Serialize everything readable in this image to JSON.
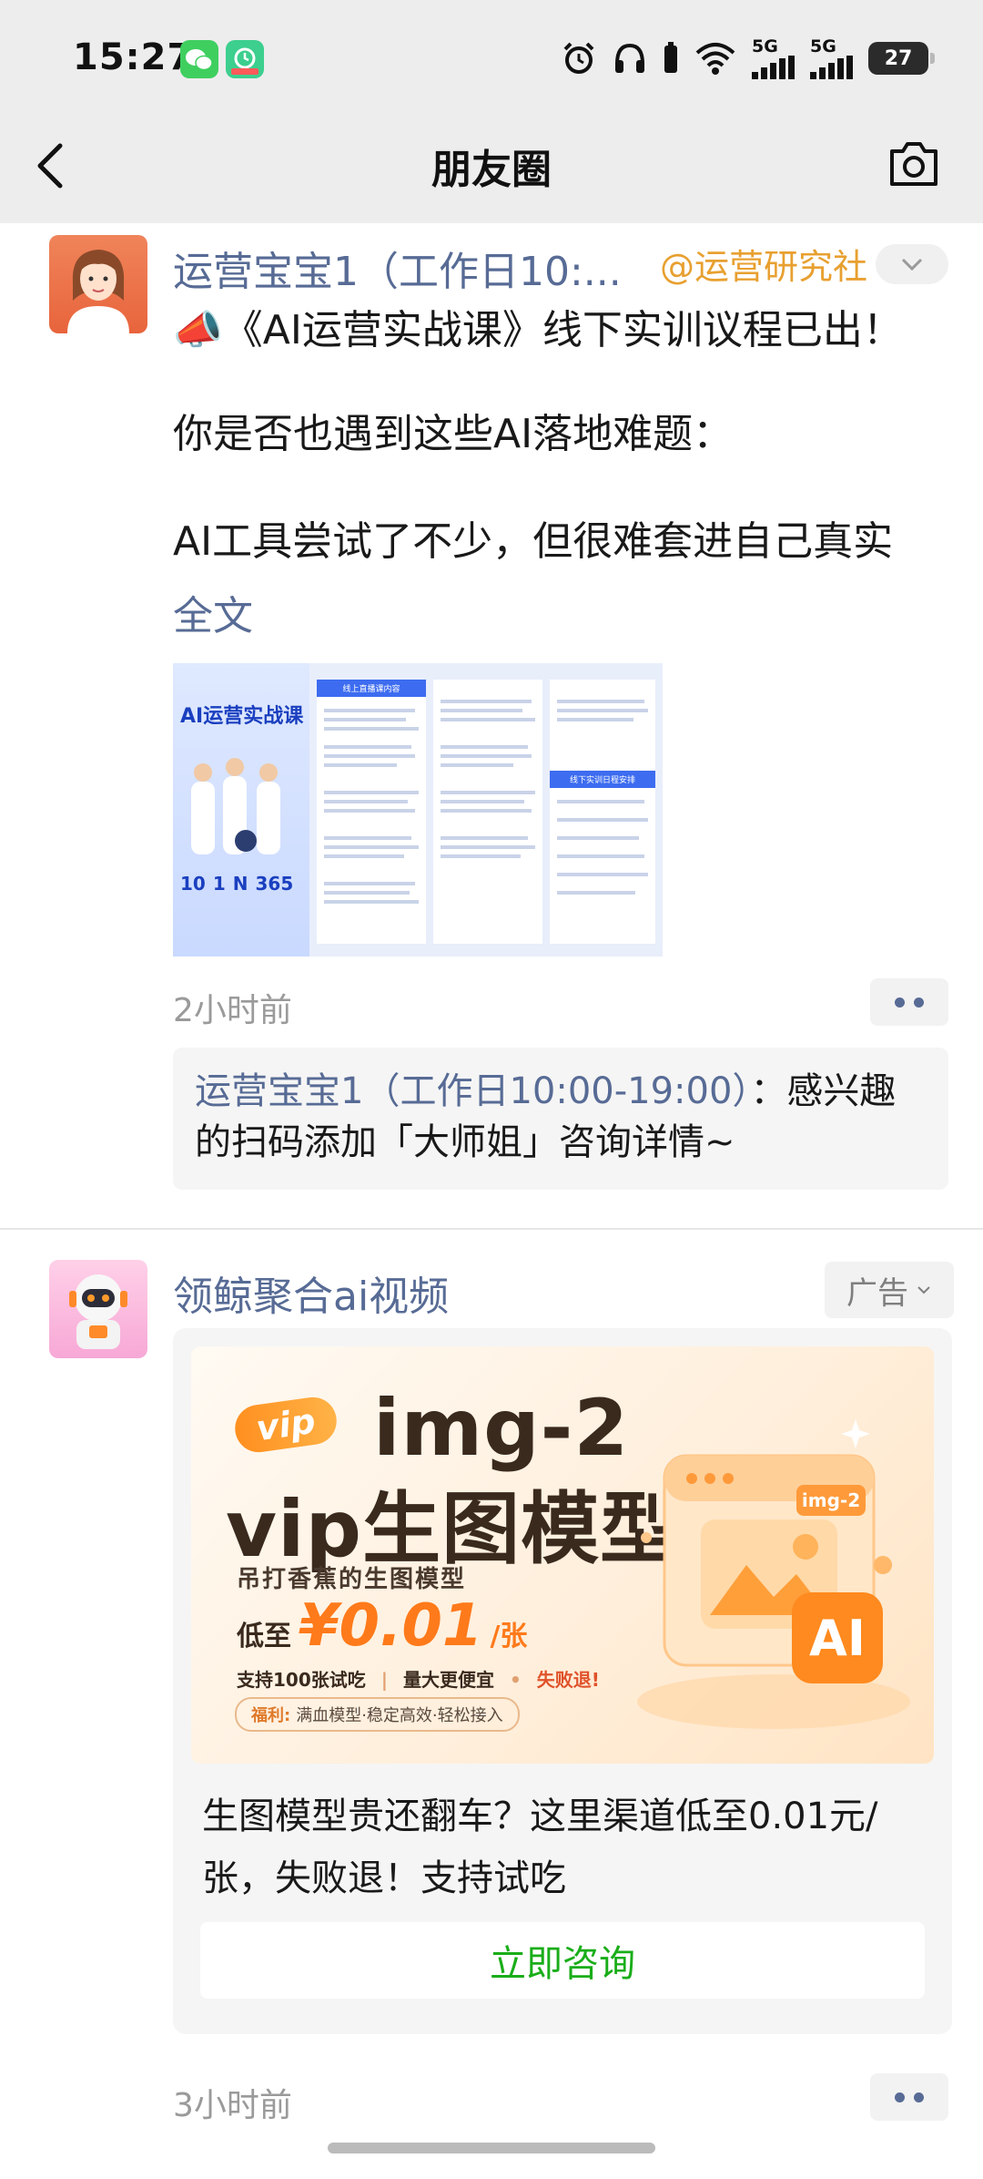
{
  "status_bar": {
    "time": "15:27",
    "signal_1": "5G",
    "signal_2": "5G",
    "battery": "27"
  },
  "nav": {
    "title": "朋友圈"
  },
  "post1": {
    "author": "运营宝宝1（工作日10:...",
    "mention": "@运营研究社",
    "lines": [
      "📣《AI运营实战课》线下实训议程已出！",
      "你是否也遇到这些AI落地难题：",
      "AI工具尝试了不少，但很难套进自己真实"
    ],
    "expand": "全文",
    "poster": {
      "title": "AI运营实战课",
      "section_1": "线上直播课内容",
      "section_2": "线下实训日程安排",
      "stats": [
        "10",
        "1",
        "N",
        "365"
      ]
    },
    "time": "2小时前",
    "comment": {
      "name": "运营宝宝1（工作日10:00-19:00）",
      "text": "：感兴趣的扫码添加「大师姐」咨询详情~"
    }
  },
  "post2": {
    "author": "领鲸聚合ai视频",
    "ad_label": "广告",
    "banner": {
      "badge": "vip",
      "title_line1": "img-2",
      "title_line2": "vip生图模型",
      "subtitle": "吊打香蕉的生图模型",
      "price_prefix": "低至",
      "price": "¥0.01",
      "price_unit": "/张",
      "features": [
        "支持100张试吃",
        "量大更便宜",
        "失败退!"
      ],
      "welfare_label": "福利:",
      "welfare": "满血模型·稳定高效·轻松接入",
      "card_tag": "img-2",
      "ai_tag": "AI"
    },
    "text": "生图模型贵还翻车？这里渠道低至0.01元/张，失败退！支持试吃",
    "button": "立即咨询",
    "time": "3小时前"
  },
  "colors": {
    "link_blue": "#576b95",
    "green": "#1aad19",
    "bar_bg": "#ededed",
    "accent_orange": "#ff7a1a"
  }
}
